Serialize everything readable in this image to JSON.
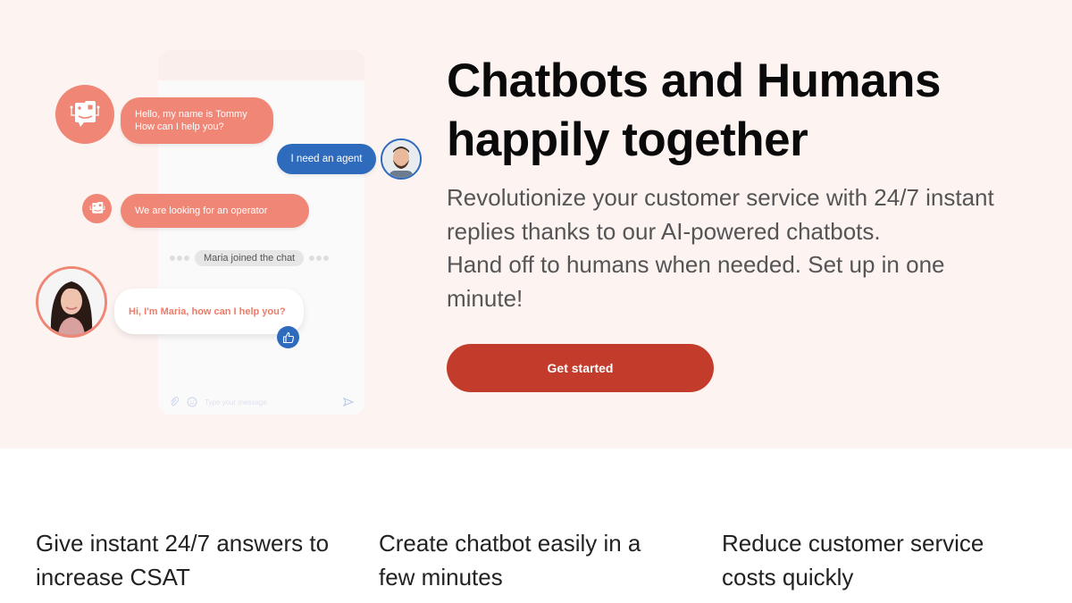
{
  "chat_widget": {
    "messages": [
      {
        "sender": "bot",
        "text_line1": "Hello, my name is Tommy",
        "text_line2": "How can I help you?"
      },
      {
        "sender": "user",
        "text": "I need an agent"
      },
      {
        "sender": "bot",
        "text": "We are looking for an operator"
      },
      {
        "sender": "agent",
        "text": "Hi, I'm Maria, how can I help you?"
      }
    ],
    "system_message": "Maria joined the chat",
    "input_placeholder": "Type your message",
    "icons": {
      "bot": "robot-face-icon",
      "user": "user-photo",
      "agent": "agent-photo",
      "reaction": "thumbs-up-icon",
      "attach": "paperclip-icon",
      "emoji": "smiley-icon",
      "send": "send-icon"
    }
  },
  "hero": {
    "title_line1": "Chatbots and Humans",
    "title_line2": "happily together",
    "subtitle_line1": "Revolutionize your customer service with 24/7 instant",
    "subtitle_line2": "replies thanks to our AI-powered chatbots.",
    "subtitle_line3": "Hand off to humans when needed. Set up in one",
    "subtitle_line4": "minute!",
    "cta_label": "Get started"
  },
  "features": [
    {
      "line1": "Give instant 24/7 answers to",
      "line2": "increase CSAT"
    },
    {
      "line1": "Create chatbot easily in a",
      "line2": "few minutes"
    },
    {
      "line1": "Reduce customer service",
      "line2": "costs quickly"
    }
  ],
  "colors": {
    "hero_bg": "#fdf4f2",
    "bot": "#ef8676",
    "user": "#2f6bbd",
    "cta": "#c23b2b"
  }
}
